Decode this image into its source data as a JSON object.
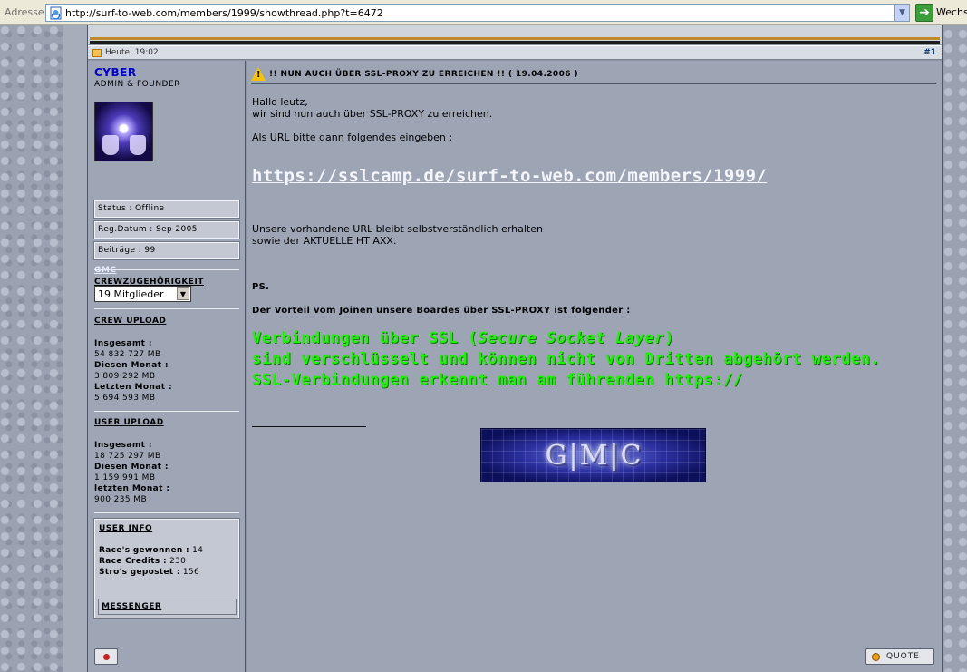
{
  "browser": {
    "address_label": "Adresse",
    "url": "http://surf-to-web.com/members/1999/showthread.php?t=6472",
    "go_label": "Wechse"
  },
  "post": {
    "date": "Heute, 19:02",
    "number": "#1",
    "title": "!! NUN AUCH ÜBER SSL-PROXY ZU ERREICHEN !! ( 19.04.2006 )"
  },
  "user": {
    "name": "CYBER",
    "role": "ADMIN & FOUNDER",
    "status": "Status : Offline",
    "reg_date": "Reg.Datum : Sep 2005",
    "posts": "Beiträge : 99",
    "crew_heading": "CREWZUGEHÖRIGKEIT",
    "crew_name": "GMC",
    "members_select": "19 Mitglieder",
    "crew_upload": {
      "heading": "CREW UPLOAD",
      "total_label": "Insgesamt :",
      "total_value": "54 832 727 MB",
      "month_label": "Diesen Monat :",
      "month_value": "3 809 292 MB",
      "last_label": "Letzten Monat :",
      "last_value": "5 694 593 MB"
    },
    "user_upload": {
      "heading": "USER UPLOAD",
      "total_label": "Insgesamt :",
      "total_value": "18 725 297 MB",
      "month_label": "Diesen Monat :",
      "month_value": "1 159 991 MB",
      "last_label": "letzten Monat :",
      "last_value": "900 235 MB"
    },
    "info": {
      "heading": "USER INFO",
      "races_label": "Race's gewonnen :",
      "races_value": "14",
      "credits_label": "Race Credits :",
      "credits_value": "230",
      "stros_label": "Stro's gepostet :",
      "stros_value": "156",
      "messenger": "MESSENGER"
    }
  },
  "message": {
    "line1": "Hallo leutz,",
    "line2": "wir sind nun auch über SSL-PROXY zu erreichen.",
    "line3": "Als URL bitte dann folgendes eingeben :",
    "link": "https://sslcamp.de/surf-to-web.com/members/1999/",
    "line4": "Unsere vorhandene URL bleibt selbstverständlich erhalten",
    "line5": "sowie der AKTUELLE HT AXX.",
    "ps": "PS.",
    "vorteil": "Der Vorteil vom Joinen unsere Boardes über SSL-PROXY ist folgender :",
    "green1_a": "Verbindungen über SSL (",
    "green1_b": "Secure Socket Layer",
    "green1_c": ")",
    "green2": "sind verschlüsselt und können nicht von Dritten abgehört werden.",
    "green3": "SSL-Verbindungen erkennt man am führenden https://",
    "banner_text": "G|M|C",
    "quote": "QUOTE"
  }
}
